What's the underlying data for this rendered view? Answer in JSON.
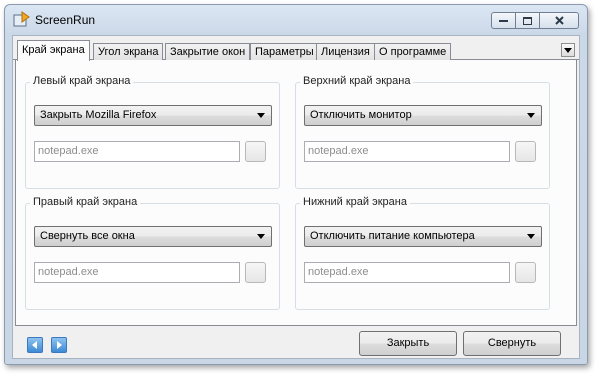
{
  "window": {
    "title": "ScreenRun"
  },
  "tabs": [
    {
      "label": "Край экрана",
      "active": true
    },
    {
      "label": "Угол экрана",
      "active": false
    },
    {
      "label": "Закрытие окон",
      "active": false
    },
    {
      "label": "Параметры",
      "active": false
    },
    {
      "label": "Лицензия",
      "active": false
    },
    {
      "label": "О программе",
      "active": false
    }
  ],
  "groups": {
    "left": {
      "label": "Левый край экрана",
      "action": "Закрыть Mozilla Firefox",
      "program_placeholder": "notepad.exe"
    },
    "top": {
      "label": "Верхний край экрана",
      "action": "Отключить монитор",
      "program_placeholder": "notepad.exe"
    },
    "right": {
      "label": "Правый край экрана",
      "action": "Свернуть все окна",
      "program_placeholder": "notepad.exe"
    },
    "bottom": {
      "label": "Нижний край экрана",
      "action": "Отключить питание компьютера",
      "program_placeholder": "notepad.exe"
    }
  },
  "buttons": {
    "close": "Закрыть",
    "minimize": "Свернуть"
  },
  "icons": {
    "app": "screenrun-app-icon",
    "minimize": "minimize-icon",
    "maximize": "maximize-icon",
    "close": "close-icon",
    "tabs_menu": "chevron-down-icon",
    "nav_back": "arrow-left-icon",
    "nav_forward": "arrow-right-icon"
  },
  "colors": {
    "title_bar": "#cbd8e8",
    "panel": "#fcfcfc",
    "nav_accent": "#3c8ad6"
  }
}
